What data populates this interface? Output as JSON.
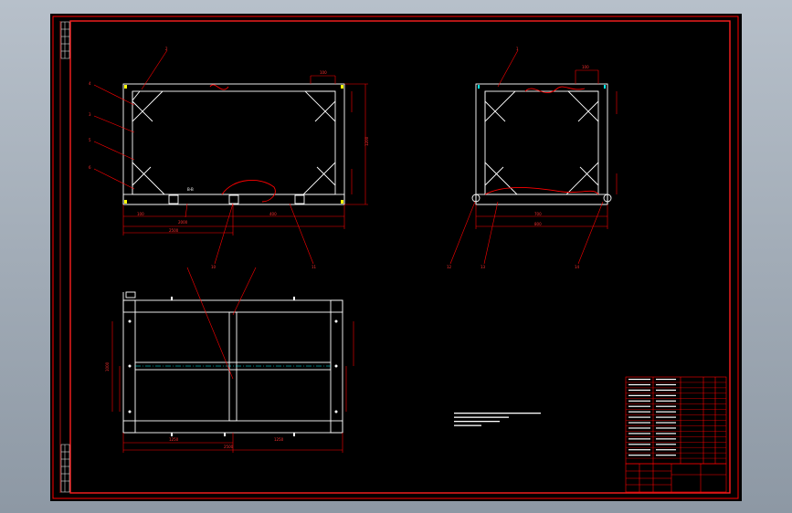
{
  "window": {
    "background": "#000000",
    "frame_color": "#ff0000",
    "line_white": "#ffffff",
    "centerline_color": "#00ffff",
    "leader_color": "#ff0000"
  },
  "drawing": {
    "title": "",
    "notes_heading": "",
    "notes": []
  }
}
